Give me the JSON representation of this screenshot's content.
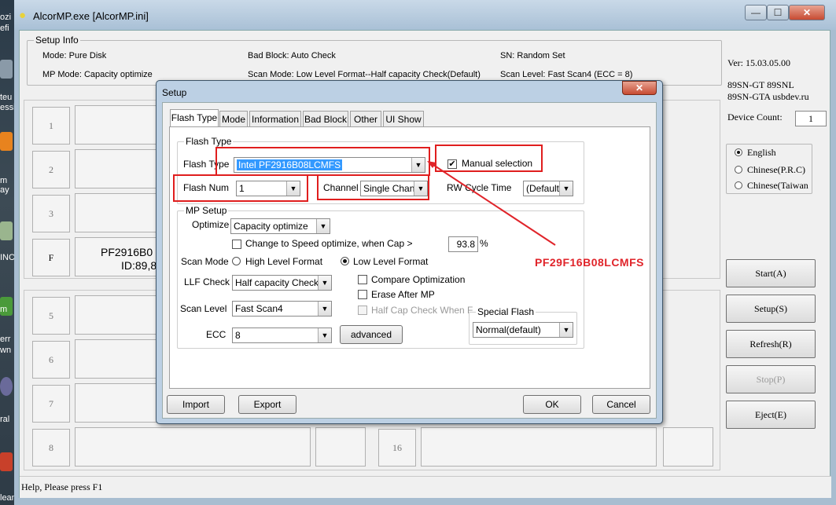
{
  "desktop": {
    "fragments": [
      "ozi",
      "efi",
      "teu",
      "essi",
      "m",
      "ay",
      "INC",
      "m",
      "err",
      "wn",
      "ral",
      "leaner"
    ]
  },
  "window": {
    "title": "AlcorMP.exe [AlcorMP.ini]",
    "min_glyph": "—",
    "max_glyph": "☐",
    "close_glyph": "✕"
  },
  "setup_info": {
    "group_label": "Setup Info",
    "mode": "Mode: Pure Disk",
    "bad_block": "Bad Block: Auto Check",
    "sn": "SN: Random Set",
    "mp_mode": "MP Mode: Capacity optimize",
    "scan_mode": "Scan Mode: Low Level Format--Half capacity Check(Default)",
    "scan_level": "Scan Level: Fast Scan4 (ECC = 8)"
  },
  "slots": {
    "left": [
      "1",
      "2",
      "3",
      "F",
      "5",
      "6",
      "7",
      "8"
    ],
    "right_bottom": "16",
    "f_line1": "PF2916B0",
    "f_line2": "ID:89,8"
  },
  "right_panel": {
    "version": "Ver: 15.03.05.00",
    "model1": "89SN-GT 89SNL",
    "model2": "89SN-GTA usbdev.ru",
    "device_count_label": "Device Count:",
    "device_count": "1",
    "languages": [
      "English",
      "Chinese(P.R.C)",
      "Chinese(Taiwan"
    ],
    "buttons": {
      "start": "Start(A)",
      "setup": "Setup(S)",
      "refresh": "Refresh(R)",
      "stop": "Stop(P)",
      "eject": "Eject(E)"
    }
  },
  "dialog": {
    "title": "Setup",
    "close_glyph": "✕",
    "tabs": [
      "Flash Type",
      "Mode",
      "Information",
      "Bad Block",
      "Other",
      "UI Show"
    ],
    "flash_type": {
      "group_label": "Flash Type",
      "flash_type_label": "Flash Type",
      "flash_type_value": "Intel PF2916B08LCMFS",
      "manual_selection_label": "Manual selection",
      "manual_selection_checked": "✔",
      "flash_num_label": "Flash Num",
      "flash_num_value": "1",
      "channel_label": "Channel",
      "channel_value": "Single Chann",
      "rw_cycle_label": "RW Cycle Time",
      "rw_cycle_value": "(Default)"
    },
    "mp_setup": {
      "group_label": "MP Setup",
      "optimize_label": "Optimize",
      "optimize_value": "Capacity optimize",
      "speed_opt_label": "Change to Speed optimize, when Cap  >",
      "speed_opt_value": "93.8",
      "percent": "%",
      "scan_mode_label": "Scan Mode",
      "high_level": "High Level Format",
      "low_level": "Low Level Format",
      "llf_check_label": "LLF Check",
      "llf_check_value": "Half capacity Check(D",
      "compare_opt": "Compare Optimization",
      "erase_after": "Erase After MP",
      "half_cap_check": "Half Cap Check When F",
      "scan_level_label": "Scan Level",
      "scan_level_value": "Fast Scan4",
      "ecc_label": "ECC",
      "ecc_value": "8",
      "advanced_label": "advanced",
      "special_flash_label": "Special Flash",
      "special_flash_value": "Normal(default)"
    },
    "buttons": {
      "import": "Import",
      "export": "Export",
      "ok": "OK",
      "cancel": "Cancel"
    }
  },
  "annotation": {
    "text": "PF29F16B08LCMFS",
    "color": "#e0242a"
  },
  "status": {
    "text": "Help, Please press F1"
  }
}
